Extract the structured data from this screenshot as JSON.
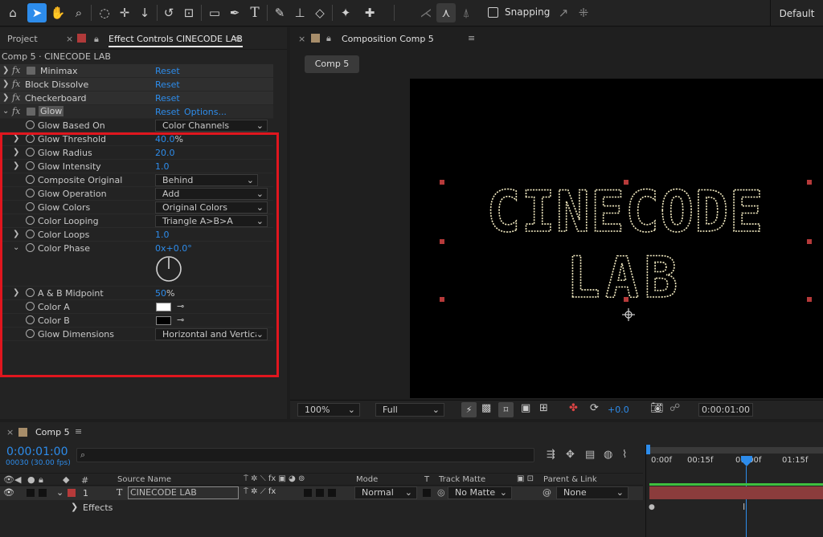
{
  "toolbar": {
    "snapping_label": "Snapping",
    "workspace": "Default"
  },
  "left_panel": {
    "tab_project": "Project",
    "tab_effect_controls": "Effect Controls CINECODE LAB",
    "breadcrumb": "Comp 5 · CINECODE LAB",
    "effects": [
      {
        "name": "Minimax",
        "reset": "Reset"
      },
      {
        "name": "Block Dissolve",
        "reset": "Reset"
      },
      {
        "name": "Checkerboard",
        "reset": "Reset"
      }
    ],
    "glow": {
      "name": "Glow",
      "reset": "Reset",
      "options": "Options...",
      "glow_based_on": {
        "label": "Glow Based On",
        "value": "Color Channels"
      },
      "glow_threshold": {
        "label": "Glow Threshold",
        "value": "40.0",
        "unit": "%"
      },
      "glow_radius": {
        "label": "Glow Radius",
        "value": "20.0"
      },
      "glow_intensity": {
        "label": "Glow Intensity",
        "value": "1.0"
      },
      "composite_original": {
        "label": "Composite Original",
        "value": "Behind"
      },
      "glow_operation": {
        "label": "Glow Operation",
        "value": "Add"
      },
      "glow_colors": {
        "label": "Glow Colors",
        "value": "Original Colors"
      },
      "color_looping": {
        "label": "Color Looping",
        "value": "Triangle A>B>A"
      },
      "color_loops": {
        "label": "Color Loops",
        "value": "1.0"
      },
      "color_phase": {
        "label": "Color Phase",
        "value": "0x+0.0°"
      },
      "ab_midpoint": {
        "label": "A & B Midpoint",
        "value": "50",
        "unit": "%"
      },
      "color_a": {
        "label": "Color A",
        "color": "#ffffff"
      },
      "color_b": {
        "label": "Color B",
        "color": "#000000"
      },
      "glow_dimensions": {
        "label": "Glow Dimensions",
        "value": "Horizontal and Vertica"
      }
    }
  },
  "comp_panel": {
    "tab": "Composition Comp 5",
    "subtab": "Comp 5",
    "text_line1": "CINECODE",
    "text_line2": "LAB",
    "zoom": "100%",
    "resolution": "Full",
    "exposure": "+0.0",
    "timecode": "0:00:01:00"
  },
  "timeline": {
    "tab": "Comp 5",
    "timecode": "0:00:01:00",
    "frames": "00030 (30.00 fps)",
    "col_hash": "#",
    "col_source": "Source Name",
    "col_mode": "Mode",
    "col_t": "T",
    "col_track_matte": "Track Matte",
    "col_parent": "Parent & Link",
    "layer_num": "1",
    "layer_name": "CINECODE LAB",
    "layer_mode": "Normal",
    "layer_matte": "No Matte",
    "layer_parent": "None",
    "effects_label": "Effects",
    "ruler": [
      "0:00f",
      "00:15f",
      "01:00f",
      "01:15f"
    ]
  }
}
